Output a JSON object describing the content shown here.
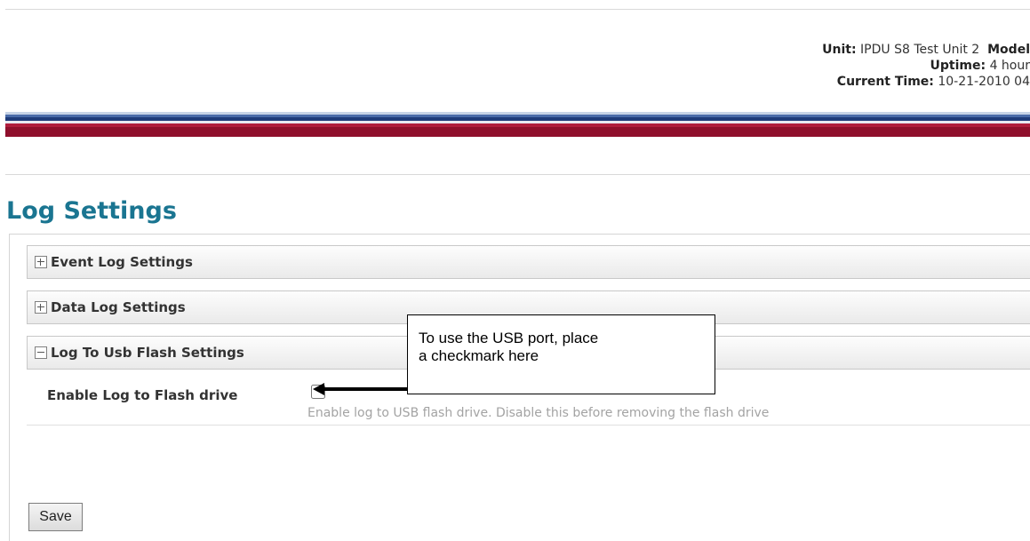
{
  "unit_info": {
    "unit_label": "Unit:",
    "unit_value": "IPDU S8 Test Unit 2",
    "model_label": "Model",
    "uptime_label": "Uptime:",
    "uptime_value": "4 hour",
    "time_label": "Current Time:",
    "time_value": "10-21-2010 04"
  },
  "page": {
    "title": "Log Settings"
  },
  "sections": [
    {
      "label": "Event Log Settings",
      "state": "collapsed",
      "icon": "plus-icon"
    },
    {
      "label": "Data Log Settings",
      "state": "collapsed",
      "icon": "plus-icon"
    },
    {
      "label": "Log To Usb Flash Settings",
      "state": "expanded",
      "icon": "minus-icon"
    }
  ],
  "usb_flash": {
    "field_label": "Enable Log to Flash drive",
    "checked": false,
    "help": "Enable log to USB flash drive. Disable this before removing the flash drive"
  },
  "callout": {
    "line1": "To use the USB port, place",
    "line2": "a checkmark here"
  },
  "actions": {
    "save_label": "Save"
  },
  "colors": {
    "title": "#1a7591",
    "banner_blue": "#1f3b79",
    "banner_red": "#8f0f2c"
  }
}
